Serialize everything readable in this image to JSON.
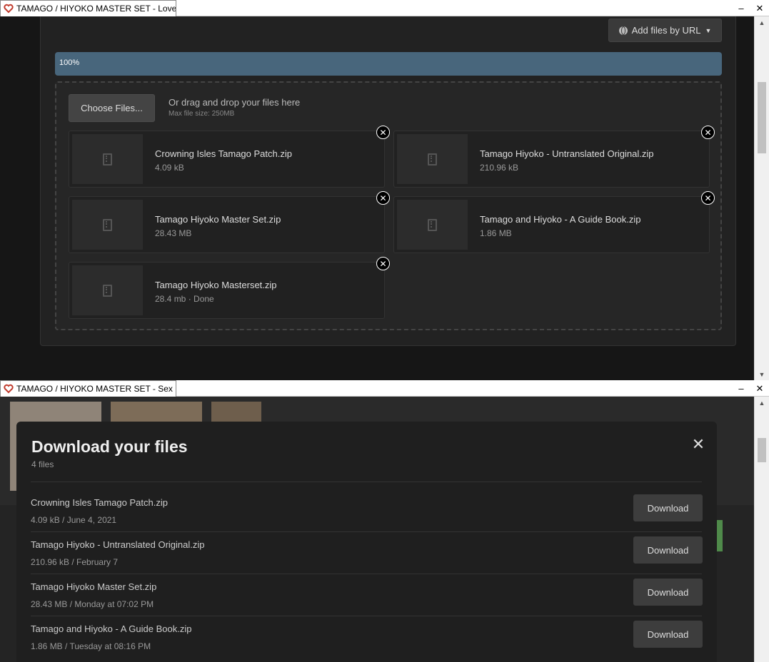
{
  "top_window": {
    "tab_title": "TAMAGO / HIYOKO MASTER SET - Lover...",
    "add_url_label": "Add files by URL",
    "progress": {
      "label": "100%",
      "value": 100
    },
    "dropzone": {
      "choose_label": "Choose Files...",
      "hint": "Or drag and drop your files here",
      "max_size": "Max file size: 250MB"
    },
    "files": [
      {
        "name": "Crowning Isles Tamago Patch.zip",
        "size": "4.09 kB"
      },
      {
        "name": "Tamago Hiyoko - Untranslated Original.zip",
        "size": "210.96 kB"
      },
      {
        "name": "Tamago Hiyoko Master Set.zip",
        "size": "28.43 MB"
      },
      {
        "name": "Tamago and Hiyoko - A Guide Book.zip",
        "size": "1.86 MB"
      },
      {
        "name": "Tamago Hiyoko Masterset.zip",
        "size": "28.4 mb · Done"
      }
    ]
  },
  "bottom_window": {
    "tab_title": "TAMAGO / HIYOKO MASTER SET - Sex E...",
    "modal": {
      "title": "Download your files",
      "count": "4 files",
      "download_label": "Download",
      "files": [
        {
          "name": "Crowning Isles Tamago Patch.zip",
          "meta": "4.09 kB / June 4, 2021"
        },
        {
          "name": "Tamago Hiyoko - Untranslated Original.zip",
          "meta": "210.96 kB / February 7"
        },
        {
          "name": "Tamago Hiyoko Master Set.zip",
          "meta": "28.43 MB / Monday at 07:02 PM"
        },
        {
          "name": "Tamago and Hiyoko - A Guide Book.zip",
          "meta": "1.86 MB / Tuesday at 08:16 PM"
        }
      ]
    }
  },
  "colors": {
    "progress": "#48667c",
    "favicon": "#c0392b"
  }
}
